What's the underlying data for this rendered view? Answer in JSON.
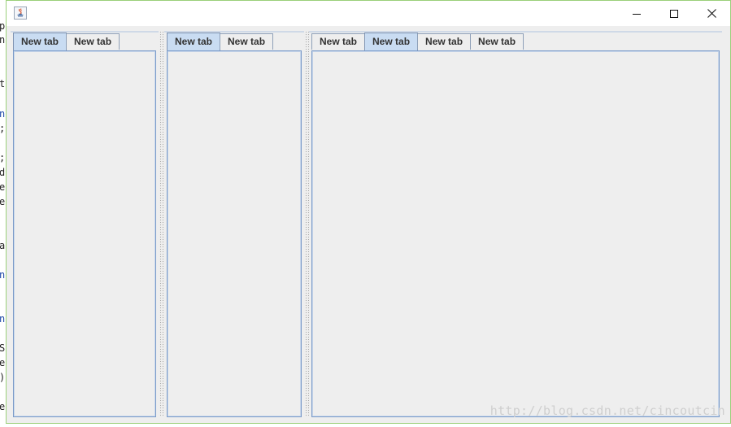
{
  "window": {
    "title": "",
    "controls": [
      "minimize-icon",
      "maximize-icon",
      "close-icon"
    ]
  },
  "panes": [
    {
      "tabs": [
        {
          "label": "New tab",
          "selected": true
        },
        {
          "label": "New tab",
          "selected": false
        }
      ]
    },
    {
      "tabs": [
        {
          "label": "New tab",
          "selected": true
        },
        {
          "label": "New tab",
          "selected": false
        }
      ]
    },
    {
      "tabs": [
        {
          "label": "New tab",
          "selected": false
        },
        {
          "label": "New tab",
          "selected": true
        },
        {
          "label": "New tab",
          "selected": false
        },
        {
          "label": "New tab",
          "selected": false
        }
      ]
    }
  ],
  "background_editor": {
    "fragments": [
      "p",
      "n",
      "t",
      "n",
      ";",
      ";",
      "d",
      "e",
      "e",
      "a",
      "n",
      "n",
      "S",
      "e",
      ")",
      "e"
    ]
  },
  "watermark": "http://blog.csdn.net/cincoutcin",
  "colors": {
    "window_border": "#9bd07a",
    "selected_tab": "#c9dcf2",
    "content_border": "#7b9bc9",
    "panel_bg": "#eeeeee"
  }
}
